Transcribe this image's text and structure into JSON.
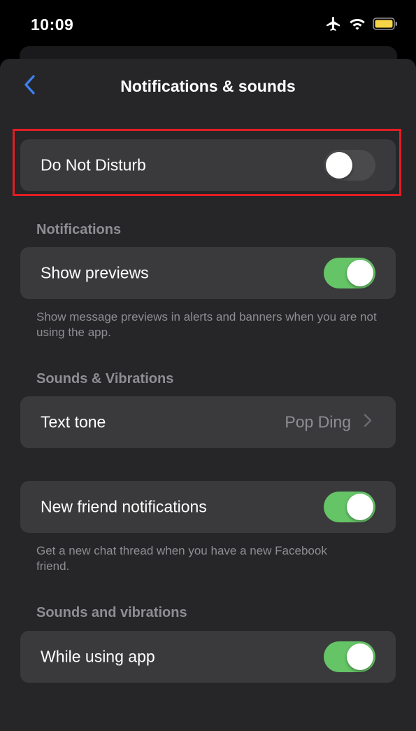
{
  "status_bar": {
    "time": "10:09",
    "icons": [
      "airplane-icon",
      "wifi-icon",
      "battery-icon"
    ],
    "battery_color": "#f5d547"
  },
  "nav": {
    "title": "Notifications & sounds",
    "back_icon": "chevron-left-icon",
    "accent": "#3b82f6"
  },
  "do_not_disturb": {
    "label": "Do Not Disturb",
    "enabled": false
  },
  "notifications": {
    "header": "Notifications",
    "show_previews": {
      "label": "Show previews",
      "enabled": true
    },
    "footnote": "Show message previews in alerts and banners when you are not using the app."
  },
  "sounds_vibrations": {
    "header": "Sounds & Vibrations",
    "text_tone": {
      "label": "Text tone",
      "value": "Pop Ding"
    }
  },
  "new_friend": {
    "label": "New friend notifications",
    "enabled": true,
    "footnote": "Get a new chat thread when you have a new Facebook friend."
  },
  "sounds_and_vibrations": {
    "header": "Sounds and vibrations",
    "while_using_app": {
      "label": "While using app",
      "enabled": true
    }
  },
  "colors": {
    "toggle_on": "#65c466",
    "toggle_off": "#4a4a4d",
    "highlight": "#e11d23"
  }
}
